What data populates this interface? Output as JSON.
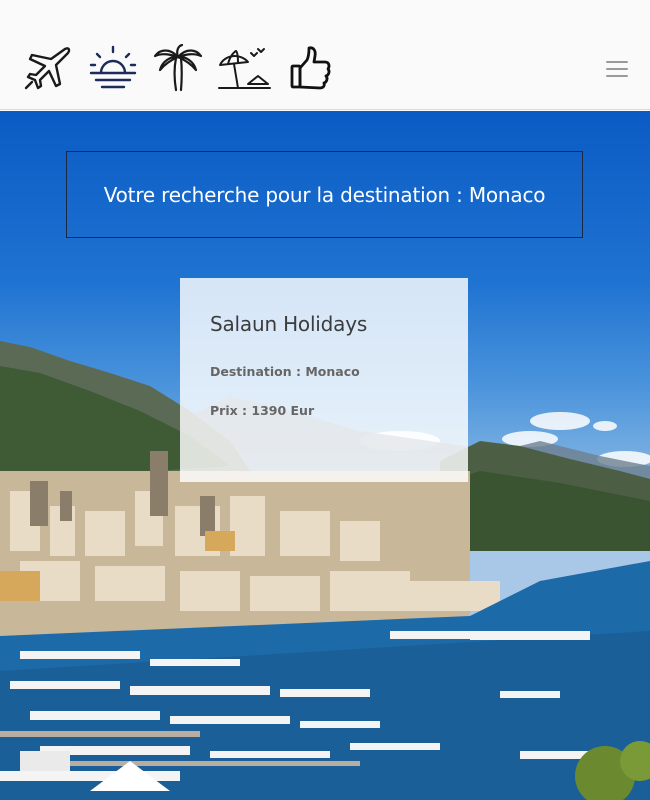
{
  "header": {
    "icons": [
      "airplane-icon",
      "sunset-icon",
      "palm-tree-icon",
      "beach-umbrella-icon",
      "thumbs-up-icon"
    ],
    "menu_icon": "hamburger-menu-icon"
  },
  "search": {
    "heading": "Votre recherche pour la destination : Monaco"
  },
  "result": {
    "title": "Salaun Holidays",
    "destination": "Destination : Monaco",
    "price": "Prix : 1390 Eur"
  },
  "colors": {
    "header_bg": "#fafafa",
    "sky": "#0a5bc4",
    "sea": "#1d6aa8",
    "icon_stroke": "#1a1a1a",
    "sunset_accent": "#1c2b5a"
  }
}
